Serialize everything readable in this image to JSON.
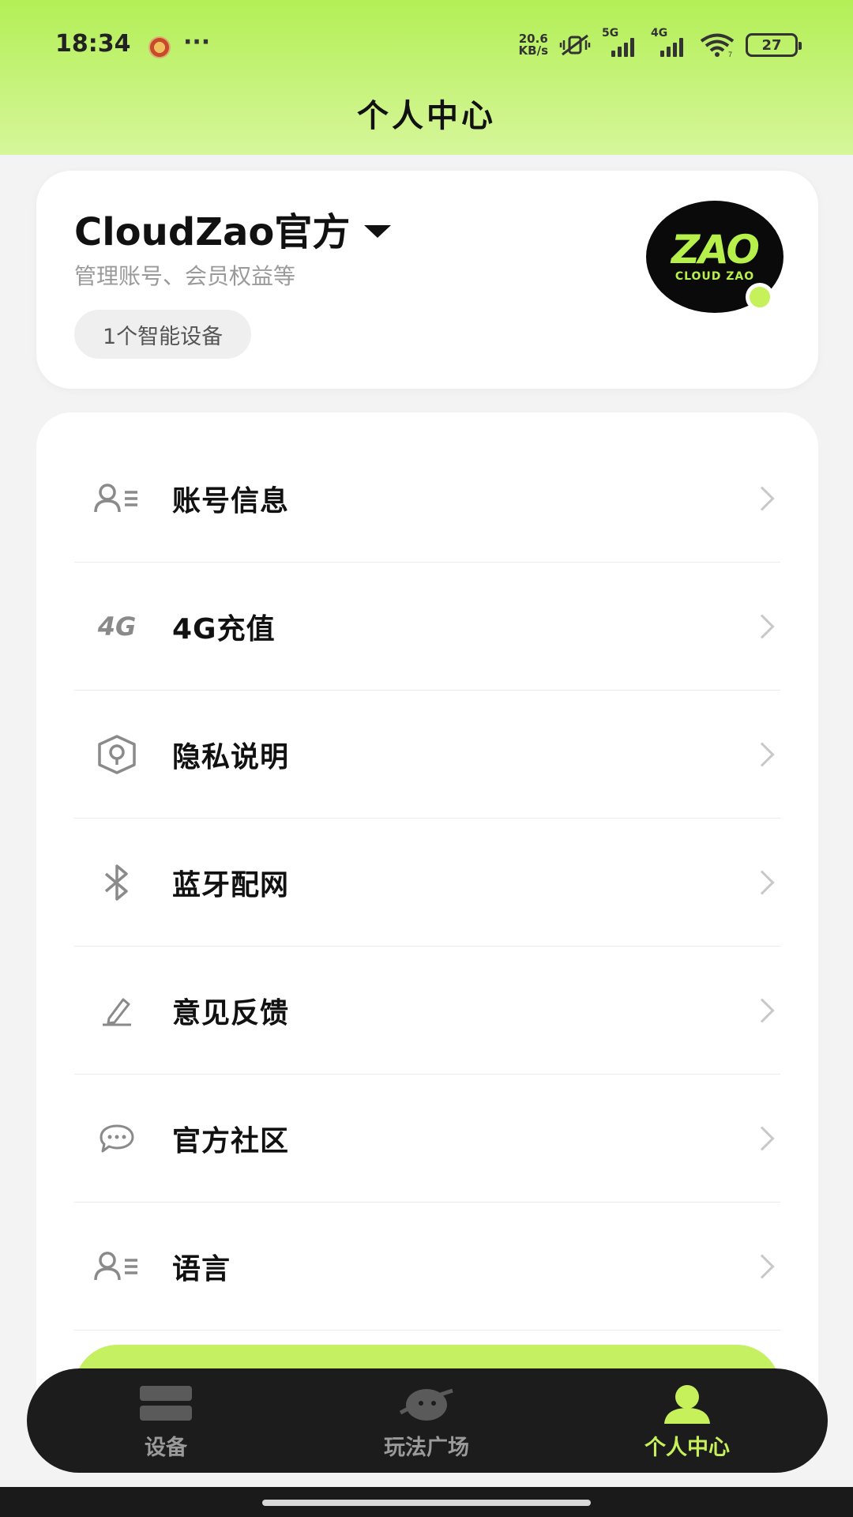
{
  "status_bar": {
    "time": "18:34",
    "dots": "···",
    "net_speed_value": "20.6",
    "net_speed_unit": "KB/s",
    "sig1_label": "5G",
    "sig2_label": "4G",
    "wifi_sub": "7",
    "battery": "27"
  },
  "header": {
    "title": "个人中心"
  },
  "profile": {
    "name": "CloudZao官方",
    "subtitle": "管理账号、会员权益等",
    "device_chip": "1个智能设备",
    "avatar_mark": "ZAO",
    "avatar_text": "CLOUD ZAO"
  },
  "menu": {
    "items": [
      {
        "label": "账号信息",
        "icon": "account-list-icon"
      },
      {
        "label": "4G充值",
        "icon": "4g-icon",
        "icon_text": "4G"
      },
      {
        "label": "隐私说明",
        "icon": "privacy-shield-icon"
      },
      {
        "label": "蓝牙配网",
        "icon": "bluetooth-icon"
      },
      {
        "label": "意见反馈",
        "icon": "pen-icon"
      },
      {
        "label": "官方社区",
        "icon": "chat-bubble-icon"
      },
      {
        "label": "语言",
        "icon": "account-list-icon"
      }
    ]
  },
  "nav": {
    "items": [
      {
        "label": "设备",
        "icon": "device-server-icon"
      },
      {
        "label": "玩法广场",
        "icon": "planet-icon"
      },
      {
        "label": "个人中心",
        "icon": "person-icon",
        "active": true
      }
    ]
  },
  "colors": {
    "accent": "#c6f15a",
    "header_top": "#b3ef56",
    "nav_bg": "#1c1c1c"
  }
}
